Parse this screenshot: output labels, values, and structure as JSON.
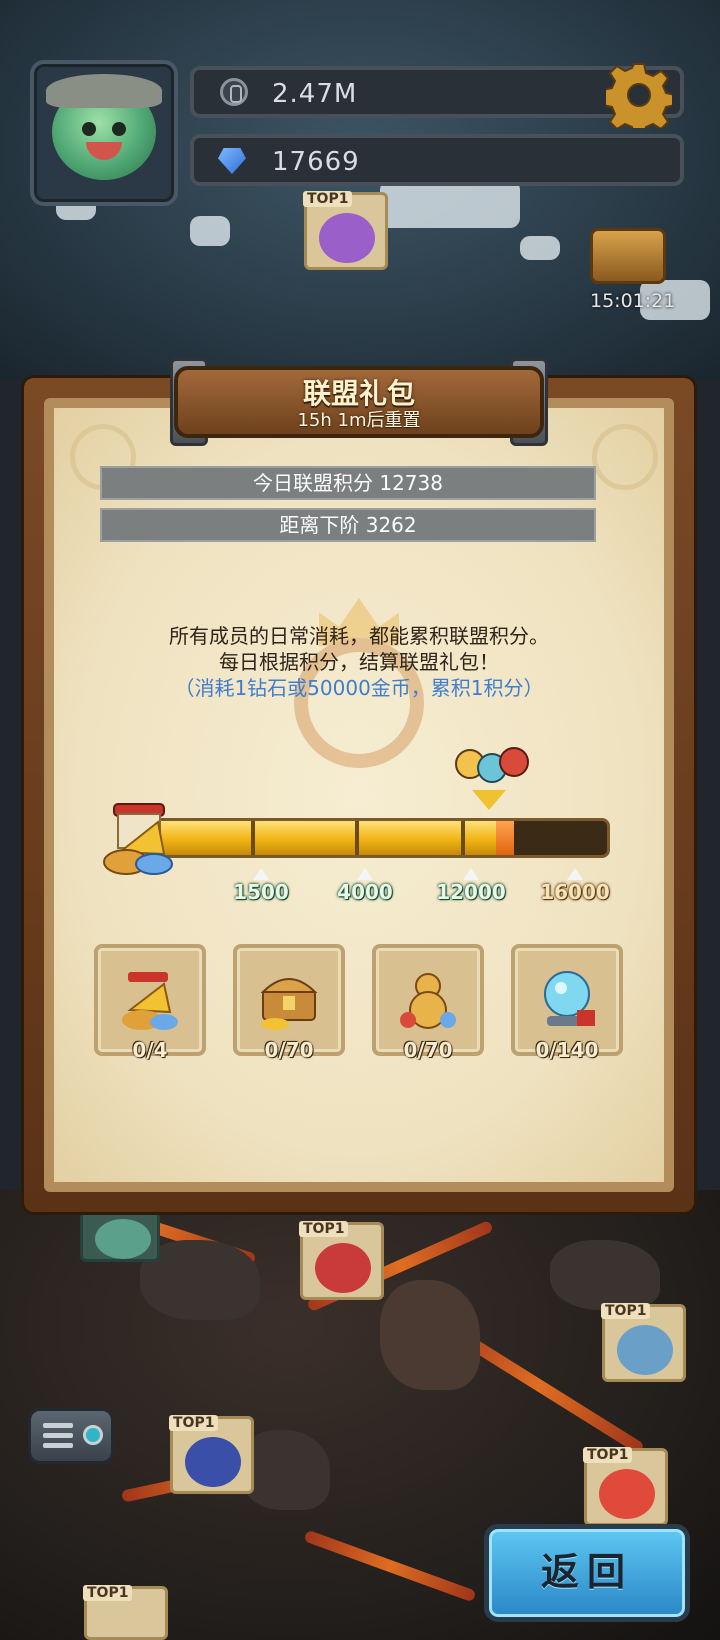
{
  "hud": {
    "gold_value": "2.47M",
    "gem_value": "17669",
    "timer": "15:01:21",
    "icons": {
      "gold": "coin-icon",
      "gem": "gem-icon",
      "settings": "gear-icon",
      "chest": "treasure-chest-icon",
      "avatar": "player-avatar"
    }
  },
  "map_markers": [
    {
      "tag": "TOP1",
      "color": "#9b5fc9"
    },
    {
      "tag": "TOP1",
      "color": "#c93a3a"
    },
    {
      "tag": "TOP1",
      "color": "#6aa0c8"
    },
    {
      "tag": "TOP1",
      "color": "#3a4fa8"
    },
    {
      "tag": "TOP1",
      "color": "#e04a3a"
    },
    {
      "tag": "TOP1",
      "color": "#4a8ac8"
    }
  ],
  "dialog": {
    "title": "联盟礼包",
    "subtitle": "15h 1m后重置",
    "today_points": "今日联盟积分 12738",
    "to_next_tier": "距离下阶 3262",
    "desc_line1": "所有成员的日常消耗，都能累积联盟积分。",
    "desc_line2": "每日根据积分，结算联盟礼包！",
    "desc_line3": "（消耗1钻石或50000金币，累积1积分）",
    "progress": {
      "current_points": 12738,
      "max_points": 16000,
      "milestones": [
        {
          "label": "1500"
        },
        {
          "label": "4000"
        },
        {
          "label": "12000"
        },
        {
          "label": "16000"
        }
      ]
    },
    "rewards": [
      {
        "count": "0/4",
        "icon": "gold-horn-chest-icon"
      },
      {
        "count": "0/70",
        "icon": "treasure-chest-icon"
      },
      {
        "count": "0/70",
        "icon": "gold-gourd-icon"
      },
      {
        "count": "0/140",
        "icon": "magic-orb-icon"
      }
    ]
  },
  "buttons": {
    "back": "返回",
    "menu_icon": "menu-icon"
  },
  "colors": {
    "progress_fill": "#f0b414",
    "progress_tip": "#e0640d",
    "back_button": "#3aa6e0",
    "desc_highlight": "#3f7ecf"
  }
}
